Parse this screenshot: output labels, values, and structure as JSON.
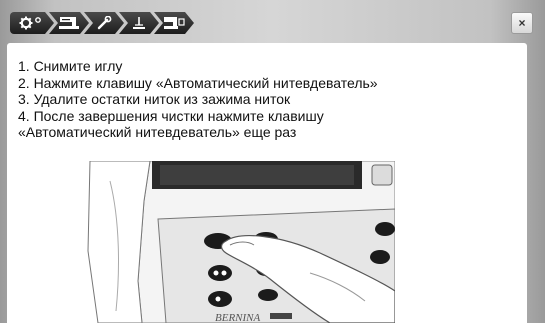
{
  "toolbar": {
    "tabs": [
      {
        "icon": "settings-gear-icon"
      },
      {
        "icon": "sewing-machine-icon"
      },
      {
        "icon": "wrench-icon"
      },
      {
        "icon": "needle-threader-icon"
      },
      {
        "icon": "machine-help-icon"
      }
    ],
    "close_label": "×"
  },
  "instructions": {
    "lines": [
      "1. Снимите иглу",
      "2. Нажмите клавишу «Автоматический нитевдеватель»",
      "3. Удалите остатки ниток из зажима ниток",
      "4. После завершения чистки нажмите клавишу",
      "«Автоматический нитевдеватель» еще раз"
    ]
  },
  "illustration": {
    "brand_text": "BERNINA",
    "description_icon": "finger-pressing-button-icon"
  },
  "colors": {
    "toolbar_dark": "#1d1d1d",
    "frame_gray": "#c2c2c2",
    "content_bg": "#ffffff"
  }
}
